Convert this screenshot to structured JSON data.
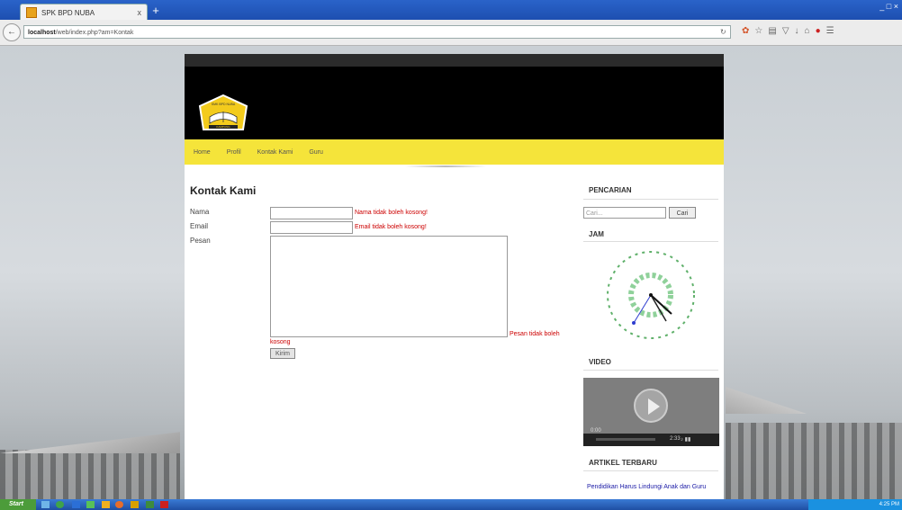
{
  "browser": {
    "tab_title": "SPK BPD NUBA",
    "tab_close": "x",
    "new_tab": "+",
    "url_host": "localhost",
    "url_rest": "/web/index.php?am=Kontak",
    "window_controls": "_ □ ×"
  },
  "site": {
    "menu": [
      "Home",
      "Profil",
      "Kontak Kami",
      "Guru"
    ],
    "logo_text": "SMK BPD NUBA",
    "logo_sub": "KAMPUNG"
  },
  "contact": {
    "title": "Kontak Kami",
    "label_nama": "Nama",
    "label_email": "Email",
    "label_pesan": "Pesan",
    "err_nama": "Nama tidak boleh kosong!",
    "err_email": "Email tidak boleh kosong!",
    "err_pesan_1": "Pesan tidak boleh",
    "err_pesan_2": "kosong",
    "submit_label": "Kirim"
  },
  "sidebar": {
    "search_title": "PENCARIAN",
    "search_placeholder": "Cari...",
    "search_button": "Cari",
    "clock_title": "JAM",
    "video_title": "VIDEO",
    "video_time_current": "0:00",
    "video_time_total": "2:33",
    "articles_title": "ARTIKEL TERBARU",
    "article_1": "Pendidikan Harus Lindungi Anak dan Guru"
  },
  "taskbar": {
    "start_label": "Start",
    "clock": "4:25 PM"
  },
  "colors": {
    "menu_yellow": "#f5e43a",
    "header_black": "#000000",
    "error_red": "#cc0000",
    "taskbar_blue": "#1f4fa3"
  }
}
